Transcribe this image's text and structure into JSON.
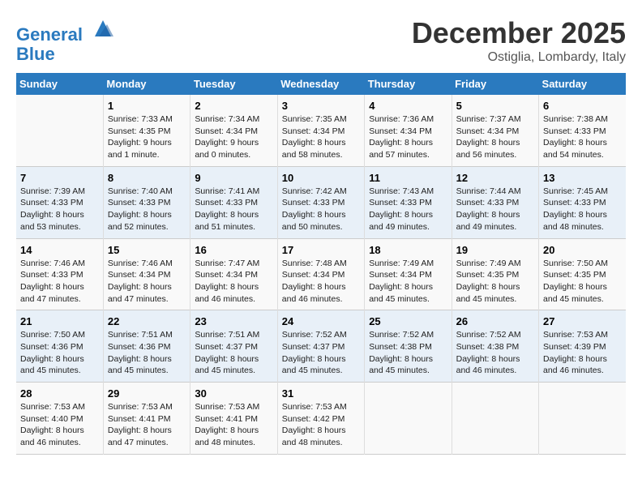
{
  "header": {
    "logo_line1": "General",
    "logo_line2": "Blue",
    "month": "December 2025",
    "location": "Ostiglia, Lombardy, Italy"
  },
  "weekdays": [
    "Sunday",
    "Monday",
    "Tuesday",
    "Wednesday",
    "Thursday",
    "Friday",
    "Saturday"
  ],
  "weeks": [
    [
      {
        "day": "",
        "detail": ""
      },
      {
        "day": "1",
        "detail": "Sunrise: 7:33 AM\nSunset: 4:35 PM\nDaylight: 9 hours\nand 1 minute."
      },
      {
        "day": "2",
        "detail": "Sunrise: 7:34 AM\nSunset: 4:34 PM\nDaylight: 9 hours\nand 0 minutes."
      },
      {
        "day": "3",
        "detail": "Sunrise: 7:35 AM\nSunset: 4:34 PM\nDaylight: 8 hours\nand 58 minutes."
      },
      {
        "day": "4",
        "detail": "Sunrise: 7:36 AM\nSunset: 4:34 PM\nDaylight: 8 hours\nand 57 minutes."
      },
      {
        "day": "5",
        "detail": "Sunrise: 7:37 AM\nSunset: 4:34 PM\nDaylight: 8 hours\nand 56 minutes."
      },
      {
        "day": "6",
        "detail": "Sunrise: 7:38 AM\nSunset: 4:33 PM\nDaylight: 8 hours\nand 54 minutes."
      }
    ],
    [
      {
        "day": "7",
        "detail": "Sunrise: 7:39 AM\nSunset: 4:33 PM\nDaylight: 8 hours\nand 53 minutes."
      },
      {
        "day": "8",
        "detail": "Sunrise: 7:40 AM\nSunset: 4:33 PM\nDaylight: 8 hours\nand 52 minutes."
      },
      {
        "day": "9",
        "detail": "Sunrise: 7:41 AM\nSunset: 4:33 PM\nDaylight: 8 hours\nand 51 minutes."
      },
      {
        "day": "10",
        "detail": "Sunrise: 7:42 AM\nSunset: 4:33 PM\nDaylight: 8 hours\nand 50 minutes."
      },
      {
        "day": "11",
        "detail": "Sunrise: 7:43 AM\nSunset: 4:33 PM\nDaylight: 8 hours\nand 49 minutes."
      },
      {
        "day": "12",
        "detail": "Sunrise: 7:44 AM\nSunset: 4:33 PM\nDaylight: 8 hours\nand 49 minutes."
      },
      {
        "day": "13",
        "detail": "Sunrise: 7:45 AM\nSunset: 4:33 PM\nDaylight: 8 hours\nand 48 minutes."
      }
    ],
    [
      {
        "day": "14",
        "detail": "Sunrise: 7:46 AM\nSunset: 4:33 PM\nDaylight: 8 hours\nand 47 minutes."
      },
      {
        "day": "15",
        "detail": "Sunrise: 7:46 AM\nSunset: 4:34 PM\nDaylight: 8 hours\nand 47 minutes."
      },
      {
        "day": "16",
        "detail": "Sunrise: 7:47 AM\nSunset: 4:34 PM\nDaylight: 8 hours\nand 46 minutes."
      },
      {
        "day": "17",
        "detail": "Sunrise: 7:48 AM\nSunset: 4:34 PM\nDaylight: 8 hours\nand 46 minutes."
      },
      {
        "day": "18",
        "detail": "Sunrise: 7:49 AM\nSunset: 4:34 PM\nDaylight: 8 hours\nand 45 minutes."
      },
      {
        "day": "19",
        "detail": "Sunrise: 7:49 AM\nSunset: 4:35 PM\nDaylight: 8 hours\nand 45 minutes."
      },
      {
        "day": "20",
        "detail": "Sunrise: 7:50 AM\nSunset: 4:35 PM\nDaylight: 8 hours\nand 45 minutes."
      }
    ],
    [
      {
        "day": "21",
        "detail": "Sunrise: 7:50 AM\nSunset: 4:36 PM\nDaylight: 8 hours\nand 45 minutes."
      },
      {
        "day": "22",
        "detail": "Sunrise: 7:51 AM\nSunset: 4:36 PM\nDaylight: 8 hours\nand 45 minutes."
      },
      {
        "day": "23",
        "detail": "Sunrise: 7:51 AM\nSunset: 4:37 PM\nDaylight: 8 hours\nand 45 minutes."
      },
      {
        "day": "24",
        "detail": "Sunrise: 7:52 AM\nSunset: 4:37 PM\nDaylight: 8 hours\nand 45 minutes."
      },
      {
        "day": "25",
        "detail": "Sunrise: 7:52 AM\nSunset: 4:38 PM\nDaylight: 8 hours\nand 45 minutes."
      },
      {
        "day": "26",
        "detail": "Sunrise: 7:52 AM\nSunset: 4:38 PM\nDaylight: 8 hours\nand 46 minutes."
      },
      {
        "day": "27",
        "detail": "Sunrise: 7:53 AM\nSunset: 4:39 PM\nDaylight: 8 hours\nand 46 minutes."
      }
    ],
    [
      {
        "day": "28",
        "detail": "Sunrise: 7:53 AM\nSunset: 4:40 PM\nDaylight: 8 hours\nand 46 minutes."
      },
      {
        "day": "29",
        "detail": "Sunrise: 7:53 AM\nSunset: 4:41 PM\nDaylight: 8 hours\nand 47 minutes."
      },
      {
        "day": "30",
        "detail": "Sunrise: 7:53 AM\nSunset: 4:41 PM\nDaylight: 8 hours\nand 48 minutes."
      },
      {
        "day": "31",
        "detail": "Sunrise: 7:53 AM\nSunset: 4:42 PM\nDaylight: 8 hours\nand 48 minutes."
      },
      {
        "day": "",
        "detail": ""
      },
      {
        "day": "",
        "detail": ""
      },
      {
        "day": "",
        "detail": ""
      }
    ]
  ]
}
